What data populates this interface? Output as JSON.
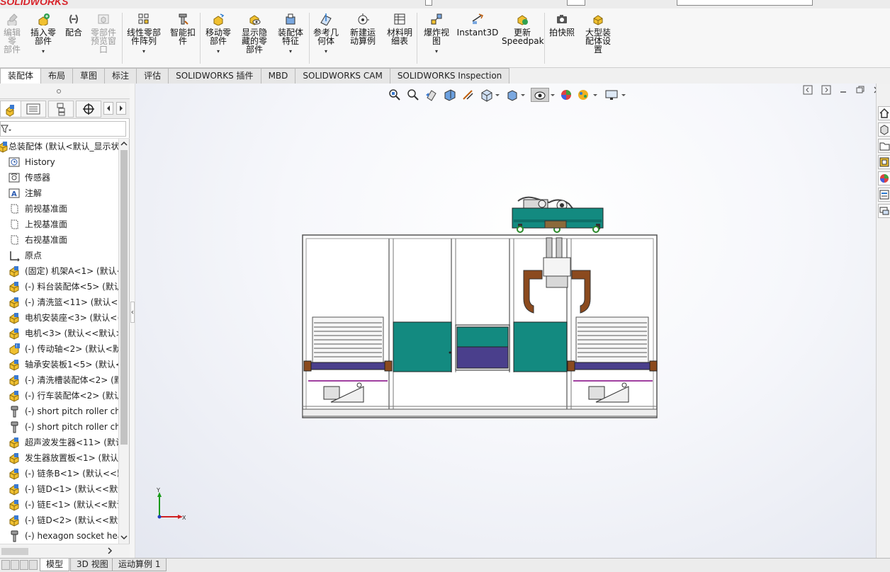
{
  "app": {
    "logo": "SOLIDWORKS"
  },
  "ribbon": {
    "buttons": [
      {
        "id": "edit-component",
        "label": "编辑零\n部件",
        "disabled": true,
        "icon": "edit-component-icon"
      },
      {
        "id": "insert-component",
        "label": "插入零\n部件",
        "drop": "▾",
        "icon": "insert-component-icon"
      },
      {
        "id": "mate",
        "label": "配合",
        "icon": "mate-icon"
      },
      {
        "id": "component-preview",
        "label": "零部件\n预览窗\n口",
        "disabled": true,
        "icon": "component-preview-icon"
      },
      {
        "id": "linear-pattern",
        "label": "线性零部\n件阵列",
        "drop": "▾",
        "icon": "linear-pattern-icon"
      },
      {
        "id": "smart-fasteners",
        "label": "智能扣\n件",
        "icon": "smart-fasteners-icon"
      },
      {
        "id": "move-component",
        "label": "移动零\n部件",
        "drop": "▾",
        "icon": "move-component-icon"
      },
      {
        "id": "show-hidden",
        "label": "显示隐\n藏的零\n部件",
        "icon": "show-hidden-icon"
      },
      {
        "id": "assembly-features",
        "label": "装配体\n特征",
        "drop": "▾",
        "icon": "assembly-features-icon"
      },
      {
        "id": "reference-geometry",
        "label": "参考几\n何体",
        "drop": "▾",
        "icon": "reference-geometry-icon"
      },
      {
        "id": "new-motion-study",
        "label": "新建运\n动算例",
        "icon": "motion-study-icon"
      },
      {
        "id": "bom",
        "label": "材料明\n细表",
        "icon": "bom-icon"
      },
      {
        "id": "exploded-view",
        "label": "爆炸视\n图",
        "drop": "▾",
        "icon": "exploded-view-icon"
      },
      {
        "id": "instant3d",
        "label": "Instant3D",
        "icon": "instant3d-icon"
      },
      {
        "id": "update-speedpak",
        "label": "更新\nSpeedpak",
        "icon": "speedpak-icon"
      },
      {
        "id": "snapshot",
        "label": "拍快照",
        "icon": "camera-icon"
      },
      {
        "id": "large-assembly",
        "label": "大型装\n配体设\n置",
        "icon": "large-assembly-icon"
      }
    ]
  },
  "tabs": [
    "装配体",
    "布局",
    "草图",
    "标注",
    "评估",
    "SOLIDWORKS 插件",
    "MBD",
    "SOLIDWORKS CAM",
    "SOLIDWORKS Inspection"
  ],
  "tree": {
    "root": "总装配体 (默认<默认_显示状",
    "items": [
      {
        "icon": "history-icon",
        "label": "History"
      },
      {
        "icon": "sensor-icon",
        "label": "传感器"
      },
      {
        "icon": "annotation-icon",
        "label": "注解"
      },
      {
        "icon": "plane-icon",
        "label": "前视基准面"
      },
      {
        "icon": "plane-icon",
        "label": "上视基准面"
      },
      {
        "icon": "plane-icon",
        "label": "右视基准面"
      },
      {
        "icon": "origin-icon",
        "label": "原点"
      },
      {
        "icon": "subassembly-icon",
        "label": "(固定) 机架A<1> (默认<"
      },
      {
        "icon": "subassembly-icon",
        "label": "(-) 料台装配体<5> (默认<"
      },
      {
        "icon": "subassembly-icon",
        "label": "(-) 清洗篮<11> (默认<<"
      },
      {
        "icon": "subassembly-icon",
        "label": "电机安装座<3> (默认<<"
      },
      {
        "icon": "subassembly-icon",
        "label": "电机<3> (默认<<默认>"
      },
      {
        "icon": "part-warning-icon",
        "label": "(-) 传动轴<2> (默认<默"
      },
      {
        "icon": "subassembly-icon",
        "label": "轴承安装板1<5> (默认<"
      },
      {
        "icon": "subassembly-icon",
        "label": "(-) 清洗槽装配体<2> (默"
      },
      {
        "icon": "subassembly-icon",
        "label": "(-) 行车装配体<2> (默认"
      },
      {
        "icon": "toolbox-part-icon",
        "label": "(-) short pitch roller ch"
      },
      {
        "icon": "toolbox-part-icon",
        "label": "(-) short pitch roller ch"
      },
      {
        "icon": "subassembly-icon",
        "label": "超声波发生器<11> (默认"
      },
      {
        "icon": "subassembly-icon",
        "label": "发生器放置板<1> (默认"
      },
      {
        "icon": "subassembly-icon",
        "label": "(-) 链条B<1> (默认<<默"
      },
      {
        "icon": "subassembly-icon",
        "label": "(-) 链D<1> (默认<<默认"
      },
      {
        "icon": "subassembly-icon",
        "label": "(-) 链E<1> (默认<<默认"
      },
      {
        "icon": "subassembly-icon",
        "label": "(-) 链D<2> (默认<<默认"
      },
      {
        "icon": "toolbox-part-icon",
        "label": "(-) hexagon socket hea"
      }
    ]
  },
  "triad": {
    "x": "X",
    "y": "Y"
  },
  "bottom_tabs": [
    "模型",
    "3D 视图",
    "运动算例 1"
  ],
  "colors": {
    "teal": "#138a80",
    "purple": "#4a3f8c",
    "brown": "#8b4a1e",
    "frame": "#9a9a9a"
  }
}
